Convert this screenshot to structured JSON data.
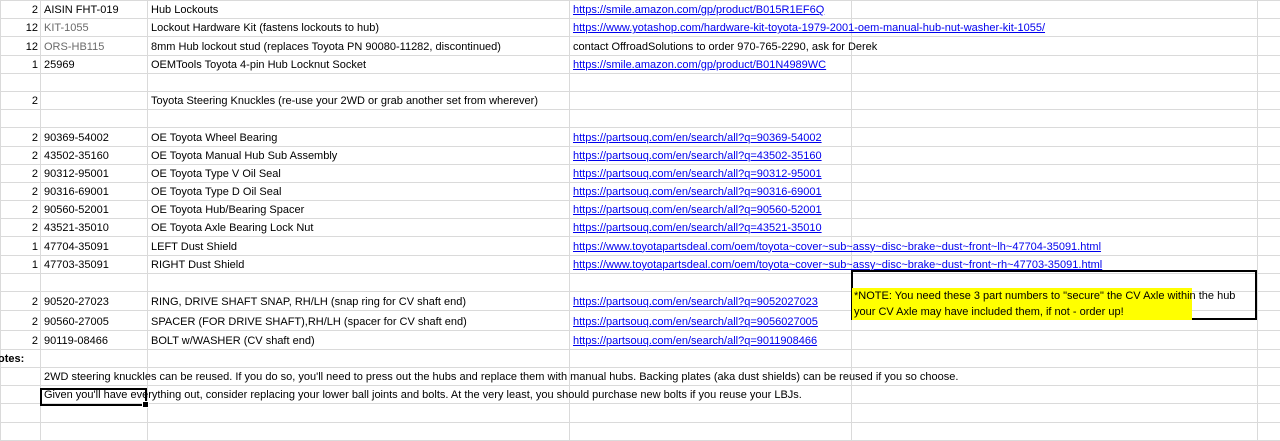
{
  "rows": [
    {
      "qty": "2",
      "part": "AISIN FHT-019",
      "desc": "Hub Lockouts",
      "link": "https://smile.amazon.com/gp/product/B015R1EF6Q"
    },
    {
      "qty": "12",
      "part": "KIT-1055",
      "desc": "Lockout Hardware Kit (fastens lockouts to hub)",
      "link": "https://www.yotashop.com/hardware-kit-toyota-1979-2001-oem-manual-hub-nut-washer-kit-1055/"
    },
    {
      "qty": "12",
      "part": "ORS-HB115",
      "desc": "8mm Hub lockout stud (replaces Toyota PN 90080-11282, discontinued)",
      "contact": "contact OffroadSolutions to order 970-765-2290, ask for Derek"
    },
    {
      "qty": "1",
      "part": "25969",
      "desc": "OEMTools Toyota 4-pin Hub Locknut Socket",
      "link": "https://smile.amazon.com/gp/product/B01N4989WC"
    },
    {
      "qty": "",
      "part": "",
      "desc": "",
      "link": ""
    },
    {
      "qty": "2",
      "part": "",
      "desc": "Toyota Steering Knuckles (re-use your 2WD or grab another set from wherever)",
      "link": ""
    },
    {
      "qty": "",
      "part": "",
      "desc": "",
      "link": ""
    },
    {
      "qty": "2",
      "part": "90369-54002",
      "desc": "OE Toyota Wheel Bearing",
      "link": "https://partsouq.com/en/search/all?q=90369-54002"
    },
    {
      "qty": "2",
      "part": "43502-35160",
      "desc": "OE Toyota Manual Hub Sub Assembly",
      "link": "https://partsouq.com/en/search/all?q=43502-35160"
    },
    {
      "qty": "2",
      "part": "90312-95001",
      "desc": "OE Toyota Type V Oil Seal",
      "link": "https://partsouq.com/en/search/all?q=90312-95001"
    },
    {
      "qty": "2",
      "part": "90316-69001",
      "desc": "OE Toyota Type D Oil Seal",
      "link": "https://partsouq.com/en/search/all?q=90316-69001"
    },
    {
      "qty": "2",
      "part": "90560-52001",
      "desc": "OE Toyota Hub/Bearing Spacer",
      "link": "https://partsouq.com/en/search/all?q=90560-52001"
    },
    {
      "qty": "2",
      "part": "43521-35010",
      "desc": "OE Toyota Axle Bearing Lock Nut",
      "link": "https://partsouq.com/en/search/all?q=43521-35010"
    },
    {
      "qty": "1",
      "part": "47704-35091",
      "desc": "LEFT Dust Shield",
      "link": "https://www.toyotapartsdeal.com/oem/toyota~cover~sub~assy~disc~brake~dust~front~lh~47704-35091.html"
    },
    {
      "qty": "1",
      "part": "47703-35091",
      "desc": "RIGHT Dust Shield",
      "link": "https://www.toyotapartsdeal.com/oem/toyota~cover~sub~assy~disc~brake~dust~front~rh~47703-35091.html"
    },
    {
      "qty": "",
      "part": "",
      "desc": "",
      "link": ""
    },
    {
      "qty": "2",
      "part": "90520-27023",
      "desc": "RING, DRIVE SHAFT SNAP, RH/LH (snap ring for CV shaft end)",
      "link": "https://partsouq.com/en/search/all?q=9052027023"
    },
    {
      "qty": "2",
      "part": "90560-27005",
      "desc": "SPACER (FOR DRIVE SHAFT),RH/LH (spacer for CV shaft end)",
      "link": "https://partsouq.com/en/search/all?q=9056027005"
    },
    {
      "qty": "2",
      "part": "90119-08466",
      "desc": "BOLT w/WASHER (CV shaft end)",
      "link": "https://partsouq.com/en/search/all?q=9011908466"
    }
  ],
  "note": {
    "line1": "*NOTE: You need these 3 part numbers to \"secure\" the CV Axle within the hub",
    "line2": "your CV Axle may have included them, if not - order up!"
  },
  "notes_label": "otes:",
  "notes": [
    "2WD steering knuckles can be reused. If you do so, you'll need to press out the hubs and replace them with manual hubs. Backing plates (aka dust shields) can be reused if you so choose.",
    "Given you'll have everything out, consider replacing your lower ball joints and bolts. At the very least, you should purchase new bolts if you reuse your LBJs."
  ]
}
